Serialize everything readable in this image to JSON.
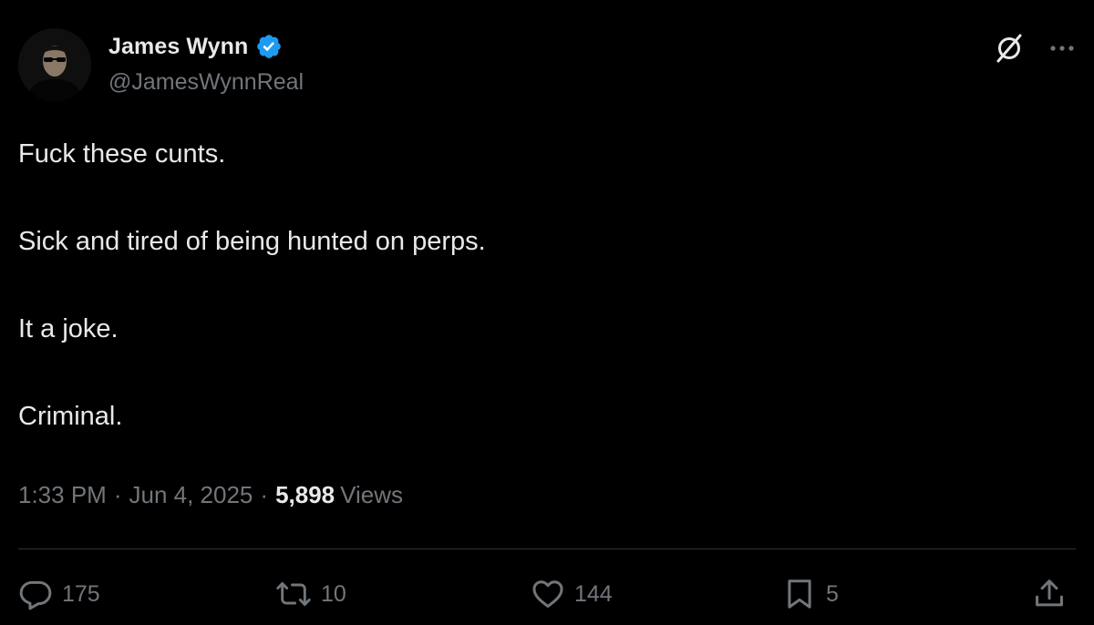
{
  "author": {
    "display_name": "James Wynn",
    "handle": "@JamesWynnReal",
    "verified": true
  },
  "tweet": {
    "lines": [
      "Fuck these cunts.",
      "Sick and tired of being hunted on perps.",
      "It a joke.",
      "Criminal."
    ],
    "time": "1:33 PM",
    "separator": "·",
    "date": "Jun 4, 2025",
    "views_count": "5,898",
    "views_label": "Views"
  },
  "engagement": {
    "replies": "175",
    "reposts": "10",
    "likes": "144",
    "bookmarks": "5"
  },
  "icons": {
    "verified": "verified-badge-icon",
    "grok": "grok-icon",
    "more": "more-dots-icon",
    "reply": "reply-icon",
    "repost": "repost-icon",
    "like": "heart-icon",
    "bookmark": "bookmark-icon",
    "share": "share-icon"
  },
  "colors": {
    "background": "#000000",
    "primary_text": "#e7e9ea",
    "secondary_text": "#71767b",
    "verified_blue": "#1d9bf0",
    "divider": "#2f3336"
  }
}
